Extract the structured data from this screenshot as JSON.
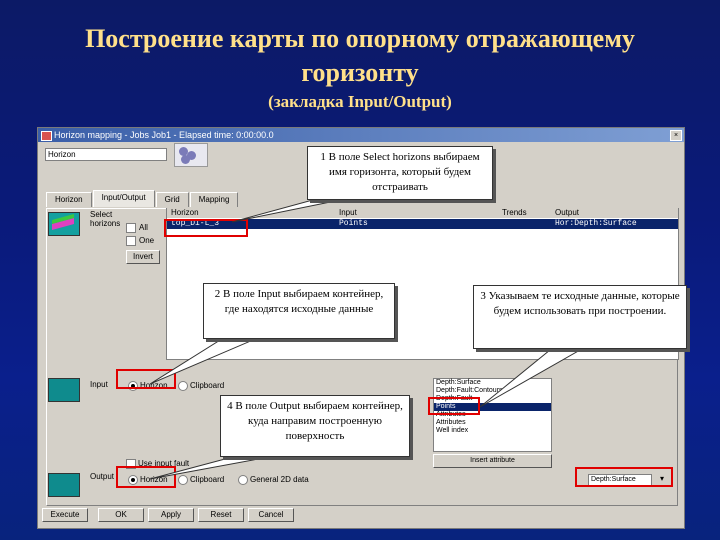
{
  "slide": {
    "title_line1": "Построение карты по опорному отражающему",
    "title_line2": "горизонту",
    "subtitle": "(закладка Input/Output)"
  },
  "window": {
    "title": "Horizon mapping - Jobs Job1 - Elapsed time: 0:00:00.0",
    "horizon_field": "Horizon",
    "tabs": [
      "Horizon",
      "Input/Output",
      "Grid",
      "Mapping"
    ],
    "select_label": "Select",
    "horizons_label": "horizons",
    "all_label": "All",
    "one_label": "One",
    "invert_label": "Invert",
    "table_headers": [
      "Horizon",
      "Input",
      "Trends",
      "Output"
    ],
    "table_row": [
      "top_D1-L_3",
      "Points",
      "",
      "Hor:Depth:Surface"
    ],
    "input_label": "Input",
    "output_label": "Output",
    "radio_horizon": "Horizon",
    "radio_clipboard": "Clipboard",
    "radio_general": "General 2D data",
    "use_input_label": "Use input fault",
    "list_items": [
      "Depth:Surface",
      "Depth:Fault:Contours",
      "Depth:Fault",
      "Points",
      "Attributes",
      "Attributes",
      "Well index"
    ],
    "list_btn": "Insert attribute",
    "output_select": "Depth:Surface",
    "buttons": [
      "Execute",
      "OK",
      "Apply",
      "Reset",
      "Cancel"
    ]
  },
  "callouts": {
    "c1": "1 В поле Select horizons выбираем имя горизонта, который будем отстраивать",
    "c2": "2 В поле Input выбираем контейнер, где находятся исходные данные",
    "c3": "3 Указываем те исходные данные, которые будем использовать при построении.",
    "c4": "4 В поле Output выбираем контейнер, куда направим построенную поверхность"
  },
  "colors": {
    "background": "#0c1a66",
    "title": "#ffe08a",
    "highlight": "#e00000"
  }
}
